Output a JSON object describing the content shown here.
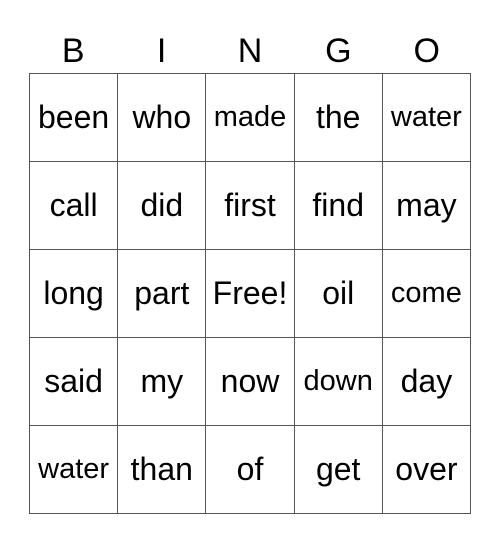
{
  "header": [
    "B",
    "I",
    "N",
    "G",
    "O"
  ],
  "rows": [
    [
      "been",
      "who",
      "made",
      "the",
      "water"
    ],
    [
      "call",
      "did",
      "first",
      "find",
      "may"
    ],
    [
      "long",
      "part",
      "Free!",
      "oil",
      "come"
    ],
    [
      "said",
      "my",
      "now",
      "down",
      "day"
    ],
    [
      "water",
      "than",
      "of",
      "get",
      "over"
    ]
  ]
}
